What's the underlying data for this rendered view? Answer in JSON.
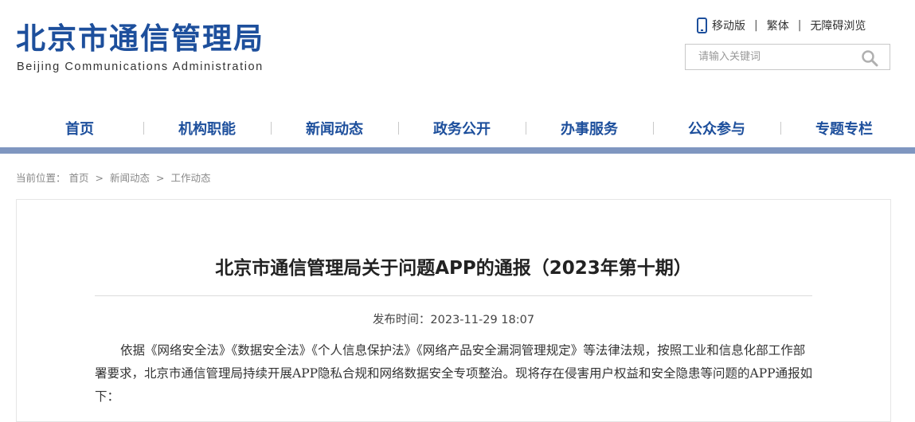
{
  "header": {
    "logo_cn": "北京市通信管理局",
    "logo_en": "Beijing Communications Administration",
    "links": [
      "移动版",
      "繁体",
      "无障碍浏览"
    ],
    "separator": "|",
    "search_placeholder": "请输入关键词",
    "search_value": ""
  },
  "nav": {
    "items": [
      "首页",
      "机构职能",
      "新闻动态",
      "政务公开",
      "办事服务",
      "公众参与",
      "专题专栏"
    ]
  },
  "breadcrumb": {
    "prefix": "当前位置：",
    "items": [
      "首页",
      "新闻动态",
      "工作动态"
    ],
    "separator": ">"
  },
  "article": {
    "title": "北京市通信管理局关于问题APP的通报（2023年第十期）",
    "pubtime": "发布时间：2023-11-29 18:07",
    "paragraph": "依据《网络安全法》《数据安全法》《个人信息保护法》《网络产品安全漏洞管理规定》等法律法规，按照工业和信息化部工作部署要求，北京市通信管理局持续开展APP隐私合规和网络数据安全专项整治。现将存在侵害用户权益和安全隐患等问题的APP通报如下："
  },
  "colors": {
    "brand_blue": "#1d4f9c",
    "nav_bar": "#7f96c0"
  },
  "icons": [
    "mobile-phone-icon",
    "search-icon"
  ]
}
